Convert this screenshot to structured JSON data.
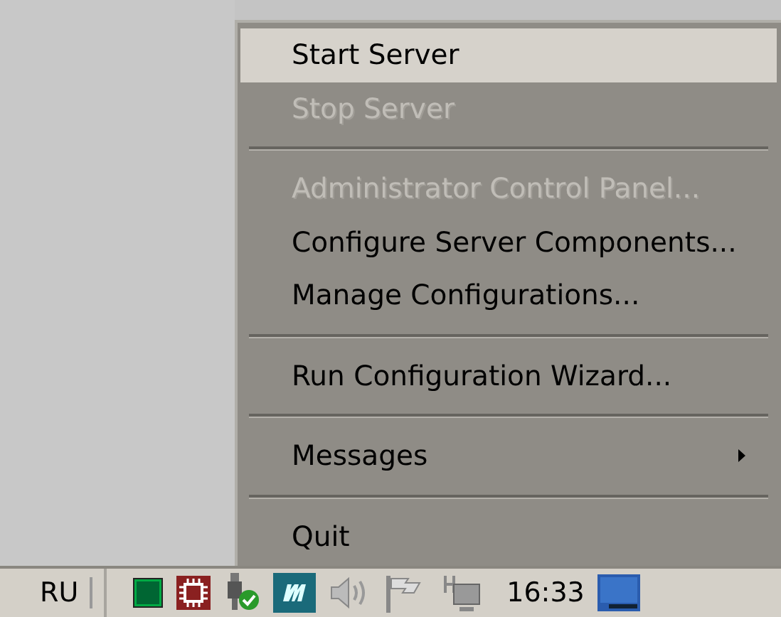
{
  "menu": {
    "items": [
      {
        "kind": "item",
        "label": "Start Server",
        "selected": true,
        "disabled": false,
        "submenu": false
      },
      {
        "kind": "item",
        "label": "Stop Server",
        "selected": false,
        "disabled": true,
        "submenu": false
      },
      {
        "kind": "separator"
      },
      {
        "kind": "item",
        "label": "Administrator Control Panel...",
        "selected": false,
        "disabled": true,
        "submenu": false
      },
      {
        "kind": "item",
        "label": "Configure Server Components...",
        "selected": false,
        "disabled": false,
        "submenu": false
      },
      {
        "kind": "item",
        "label": "Manage Configurations...",
        "selected": false,
        "disabled": false,
        "submenu": false
      },
      {
        "kind": "separator"
      },
      {
        "kind": "item",
        "label": "Run Configuration Wizard...",
        "selected": false,
        "disabled": false,
        "submenu": false
      },
      {
        "kind": "separator"
      },
      {
        "kind": "item",
        "label": "Messages",
        "selected": false,
        "disabled": false,
        "submenu": true
      },
      {
        "kind": "separator"
      },
      {
        "kind": "item",
        "label": "Quit",
        "selected": false,
        "disabled": false,
        "submenu": false
      }
    ]
  },
  "taskbar": {
    "language": "RU",
    "clock": "16:33"
  }
}
